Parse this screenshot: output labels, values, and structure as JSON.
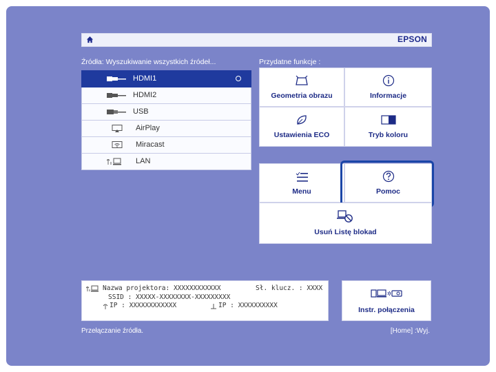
{
  "header": {
    "brand": "EPSON",
    "sources_heading": "Źródła: Wyszukiwanie wszystkich źródeł...",
    "functions_heading": "Przydatne funkcje :"
  },
  "sources": [
    {
      "label": "HDMI1",
      "icon": "hdmi-icon",
      "selected": true
    },
    {
      "label": "HDMI2",
      "icon": "hdmi-icon",
      "selected": false
    },
    {
      "label": "USB",
      "icon": "usb-icon",
      "selected": false
    },
    {
      "label": "AirPlay",
      "icon": "airplay-icon",
      "selected": false
    },
    {
      "label": "Miracast",
      "icon": "miracast-icon",
      "selected": false
    },
    {
      "label": "LAN",
      "icon": "lan-icon",
      "selected": false
    }
  ],
  "functions": {
    "geometry": "Geometria obrazu",
    "info": "Informacje",
    "eco": "Ustawienia ECO",
    "color_mode": "Tryb koloru",
    "menu": "Menu",
    "help": "Pomoc",
    "clear_blocklist": "Usuń Listę blokad"
  },
  "projector_info": {
    "name_line": "Nazwa projektora: XXXXXXXXXXXX",
    "key_line": "Sł. klucz. : XXXX",
    "ssid_line": "SSID : XXXXX-XXXXXXXX-XXXXXXXXX",
    "wifi_ip_line": "IP : XXXXXXXXXXXX",
    "lan_ip_line": "IP : XXXXXXXXXX"
  },
  "connect_guide": "Instr. połączenia",
  "status_bar": {
    "left": "Przełączanie źródła.",
    "right": "[Home] :Wyj."
  },
  "colors": {
    "background": "#7b84c9",
    "selected": "#1f3a9e",
    "focus_outline": "#1a45a7",
    "tile_text": "#1d2b86"
  }
}
